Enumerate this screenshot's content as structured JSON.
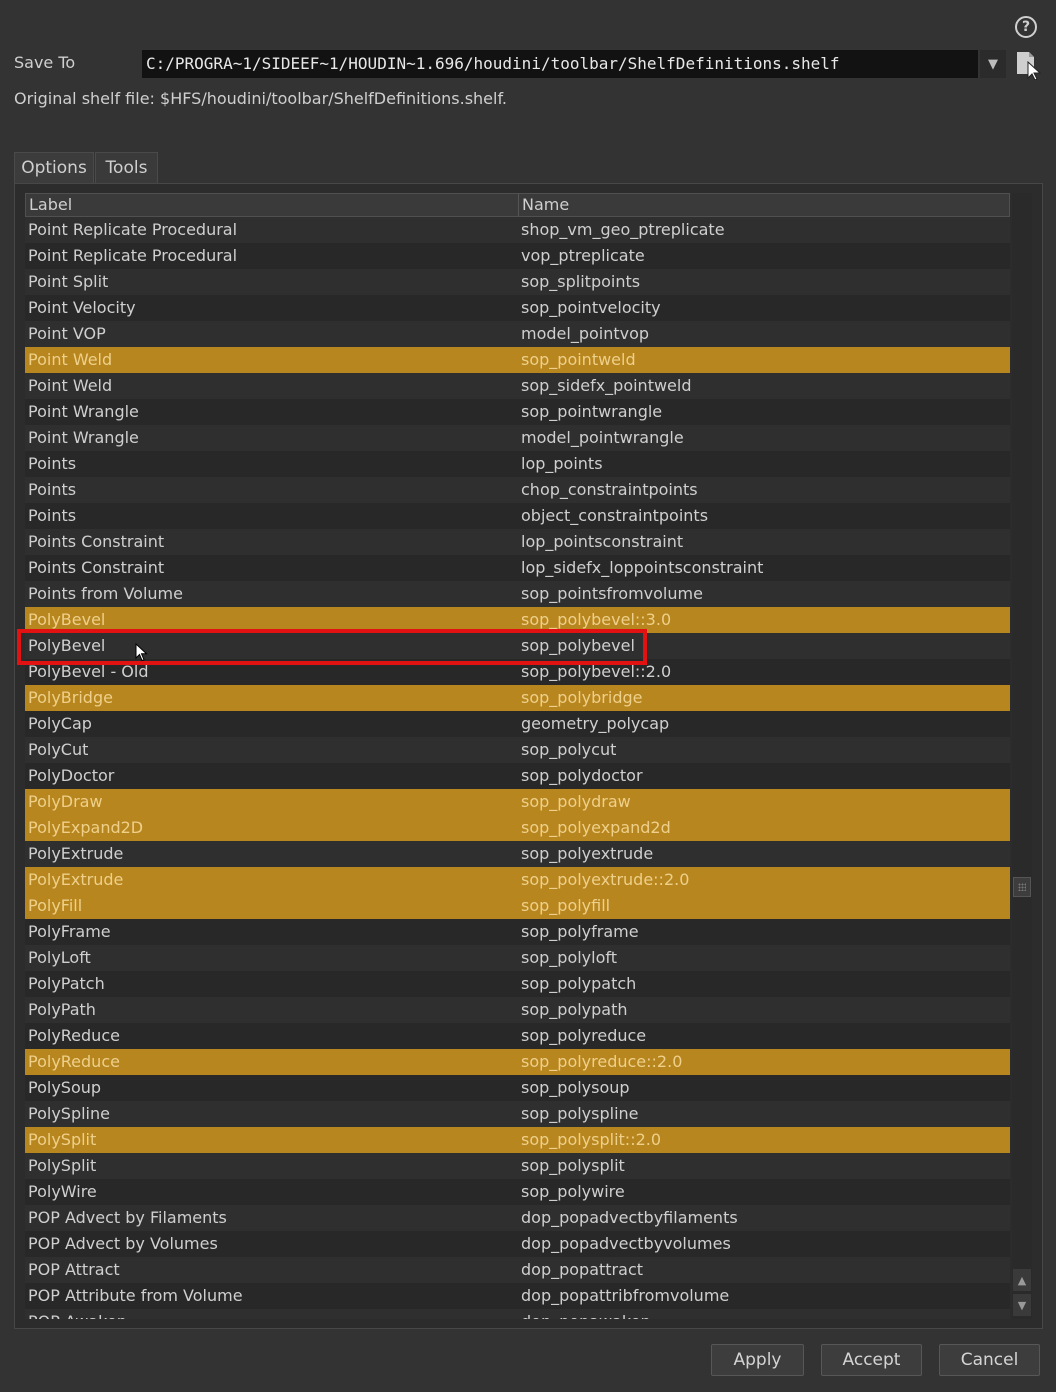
{
  "header": {
    "help_glyph": "?",
    "save_to_label": "Save To",
    "save_to_value": "C:/PROGRA~1/SIDEEF~1/HOUDIN~1.696/houdini/toolbar/ShelfDefinitions.shelf",
    "dropdown_glyph": "▼",
    "original_file_text": "Original shelf file: $HFS/houdini/toolbar/ShelfDefinitions.shelf."
  },
  "tabs": [
    {
      "label": "Options"
    },
    {
      "label": "Tools"
    }
  ],
  "table": {
    "columns": {
      "label": "Label",
      "name": "Name"
    },
    "rows": [
      {
        "label": "Point Replicate Procedural",
        "name": "shop_vm_geo_ptreplicate",
        "highlighted": false
      },
      {
        "label": "Point Replicate Procedural",
        "name": "vop_ptreplicate",
        "highlighted": false
      },
      {
        "label": "Point Split",
        "name": "sop_splitpoints",
        "highlighted": false
      },
      {
        "label": "Point Velocity",
        "name": "sop_pointvelocity",
        "highlighted": false
      },
      {
        "label": "Point VOP",
        "name": "model_pointvop",
        "highlighted": false
      },
      {
        "label": "Point Weld",
        "name": "sop_pointweld",
        "highlighted": true
      },
      {
        "label": "Point Weld",
        "name": "sop_sidefx_pointweld",
        "highlighted": false
      },
      {
        "label": "Point Wrangle",
        "name": "sop_pointwrangle",
        "highlighted": false
      },
      {
        "label": "Point Wrangle",
        "name": "model_pointwrangle",
        "highlighted": false
      },
      {
        "label": "Points",
        "name": "lop_points",
        "highlighted": false
      },
      {
        "label": "Points",
        "name": "chop_constraintpoints",
        "highlighted": false
      },
      {
        "label": "Points",
        "name": "object_constraintpoints",
        "highlighted": false
      },
      {
        "label": "Points Constraint",
        "name": "lop_pointsconstraint",
        "highlighted": false
      },
      {
        "label": "Points Constraint",
        "name": "lop_sidefx_loppointsconstraint",
        "highlighted": false
      },
      {
        "label": "Points from Volume",
        "name": "sop_pointsfromvolume",
        "highlighted": false
      },
      {
        "label": "PolyBevel",
        "name": "sop_polybevel::3.0",
        "highlighted": true
      },
      {
        "label": "PolyBevel",
        "name": "sop_polybevel",
        "highlighted": false
      },
      {
        "label": "PolyBevel - Old",
        "name": "sop_polybevel::2.0",
        "highlighted": false
      },
      {
        "label": "PolyBridge",
        "name": "sop_polybridge",
        "highlighted": true
      },
      {
        "label": "PolyCap",
        "name": "geometry_polycap",
        "highlighted": false
      },
      {
        "label": "PolyCut",
        "name": "sop_polycut",
        "highlighted": false
      },
      {
        "label": "PolyDoctor",
        "name": "sop_polydoctor",
        "highlighted": false
      },
      {
        "label": "PolyDraw",
        "name": "sop_polydraw",
        "highlighted": true
      },
      {
        "label": "PolyExpand2D",
        "name": "sop_polyexpand2d",
        "highlighted": true
      },
      {
        "label": "PolyExtrude",
        "name": "sop_polyextrude",
        "highlighted": false
      },
      {
        "label": "PolyExtrude",
        "name": "sop_polyextrude::2.0",
        "highlighted": true
      },
      {
        "label": "PolyFill",
        "name": "sop_polyfill",
        "highlighted": true
      },
      {
        "label": "PolyFrame",
        "name": "sop_polyframe",
        "highlighted": false
      },
      {
        "label": "PolyLoft",
        "name": "sop_polyloft",
        "highlighted": false
      },
      {
        "label": "PolyPatch",
        "name": "sop_polypatch",
        "highlighted": false
      },
      {
        "label": "PolyPath",
        "name": "sop_polypath",
        "highlighted": false
      },
      {
        "label": "PolyReduce",
        "name": "sop_polyreduce",
        "highlighted": false
      },
      {
        "label": "PolyReduce",
        "name": "sop_polyreduce::2.0",
        "highlighted": true
      },
      {
        "label": "PolySoup",
        "name": "sop_polysoup",
        "highlighted": false
      },
      {
        "label": "PolySpline",
        "name": "sop_polyspline",
        "highlighted": false
      },
      {
        "label": "PolySplit",
        "name": "sop_polysplit::2.0",
        "highlighted": true
      },
      {
        "label": "PolySplit",
        "name": "sop_polysplit",
        "highlighted": false
      },
      {
        "label": "PolyWire",
        "name": "sop_polywire",
        "highlighted": false
      },
      {
        "label": "POP Advect by Filaments",
        "name": "dop_popadvectbyfilaments",
        "highlighted": false
      },
      {
        "label": "POP Advect by Volumes",
        "name": "dop_popadvectbyvolumes",
        "highlighted": false
      },
      {
        "label": "POP Attract",
        "name": "dop_popattract",
        "highlighted": false
      },
      {
        "label": "POP Attribute from Volume",
        "name": "dop_popattribfromvolume",
        "highlighted": false
      },
      {
        "label": "POP Awaken",
        "name": "dop_popawaken",
        "highlighted": false
      }
    ]
  },
  "scrollbar": {
    "up_glyph": "▲",
    "down_glyph": "▼"
  },
  "buttons": {
    "apply": "Apply",
    "accept": "Accept",
    "cancel": "Cancel"
  },
  "colors": {
    "highlight": "#b8861f",
    "selection_outline": "#e21212"
  }
}
